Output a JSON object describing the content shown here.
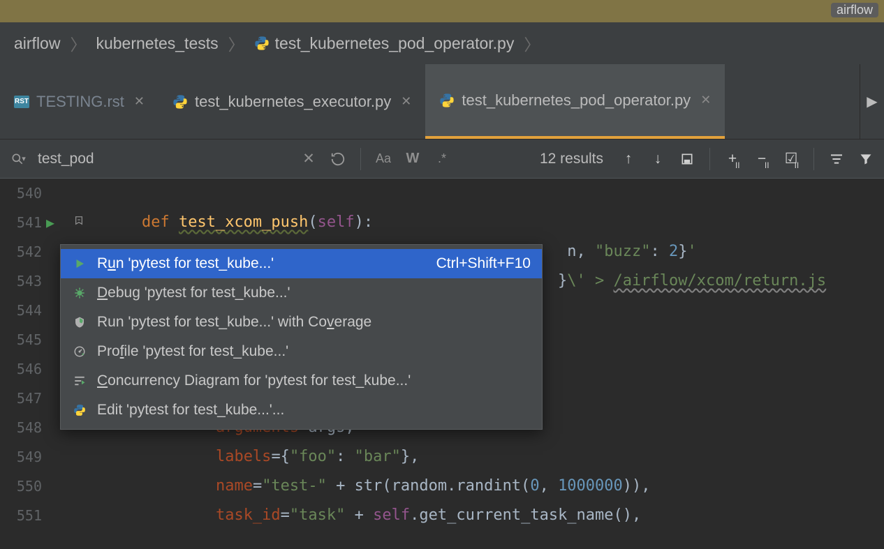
{
  "title_badge": "airflow",
  "breadcrumb": {
    "items": [
      "airflow",
      "kubernetes_tests",
      "test_kubernetes_pod_operator.py"
    ]
  },
  "tabs": [
    {
      "label": "TESTING.rst",
      "icon": "rst",
      "active": false,
      "tint": "inactive"
    },
    {
      "label": "test_kubernetes_executor.py",
      "icon": "py",
      "active": false,
      "tint": "normal"
    },
    {
      "label": "test_kubernetes_pod_operator.py",
      "icon": "py",
      "active": true,
      "tint": "normal"
    }
  ],
  "find": {
    "query": "test_pod",
    "results_label": "12 results"
  },
  "editor": {
    "first_line_no": 540,
    "lines": [
      {
        "no": 540,
        "frag": []
      },
      {
        "no": 541,
        "run_gutter": true,
        "frag": [
          {
            "cls": "",
            "t": "    "
          },
          {
            "cls": "k-def",
            "t": "def "
          },
          {
            "cls": "k-fn",
            "t": "test_xcom_push"
          },
          {
            "cls": "",
            "t": "("
          },
          {
            "cls": "k-self",
            "t": "self"
          },
          {
            "cls": "",
            "t": "):"
          }
        ]
      },
      {
        "no": 542,
        "frag": [
          {
            "cls": "",
            "t": "                                                  n, "
          },
          {
            "cls": "k-str",
            "t": "\"buzz\""
          },
          {
            "cls": "",
            "t": ": "
          },
          {
            "cls": "k-num",
            "t": "2"
          },
          {
            "cls": "",
            "t": "}"
          },
          {
            "cls": "k-str",
            "t": "'"
          }
        ]
      },
      {
        "no": 543,
        "frag": [
          {
            "cls": "",
            "t": "                                                 }"
          },
          {
            "cls": "k-str",
            "t": "\\'"
          },
          {
            "cls": "k-str",
            "t": " > "
          },
          {
            "cls": "k-path",
            "t": "/airflow/xcom/return.js"
          }
        ]
      },
      {
        "no": 544,
        "frag": []
      },
      {
        "no": 545,
        "frag": []
      },
      {
        "no": 546,
        "frag": []
      },
      {
        "no": 547,
        "frag": []
      },
      {
        "no": 548,
        "frag": [
          {
            "cls": "",
            "t": "            "
          },
          {
            "cls": "k-arg",
            "t": "arguments"
          },
          {
            "cls": "",
            "t": "=args,"
          }
        ]
      },
      {
        "no": 549,
        "frag": [
          {
            "cls": "",
            "t": "            "
          },
          {
            "cls": "k-arg",
            "t": "labels"
          },
          {
            "cls": "",
            "t": "={"
          },
          {
            "cls": "k-str",
            "t": "\"foo\""
          },
          {
            "cls": "",
            "t": ": "
          },
          {
            "cls": "k-str",
            "t": "\"bar\""
          },
          {
            "cls": "",
            "t": "},"
          }
        ]
      },
      {
        "no": 550,
        "frag": [
          {
            "cls": "",
            "t": "            "
          },
          {
            "cls": "k-arg",
            "t": "name"
          },
          {
            "cls": "",
            "t": "="
          },
          {
            "cls": "k-str",
            "t": "\"test-\""
          },
          {
            "cls": "",
            "t": " + str(random.randint("
          },
          {
            "cls": "k-num",
            "t": "0"
          },
          {
            "cls": "",
            "t": ", "
          },
          {
            "cls": "k-num",
            "t": "1000000"
          },
          {
            "cls": "",
            "t": ")),"
          }
        ]
      },
      {
        "no": 551,
        "frag": [
          {
            "cls": "",
            "t": "            "
          },
          {
            "cls": "k-arg",
            "t": "task_id"
          },
          {
            "cls": "",
            "t": "="
          },
          {
            "cls": "k-str",
            "t": "\"task\""
          },
          {
            "cls": "",
            "t": " + "
          },
          {
            "cls": "k-self",
            "t": "self"
          },
          {
            "cls": "",
            "t": ".get_current_task_name(),"
          }
        ]
      }
    ]
  },
  "context_menu": [
    {
      "icon": "run",
      "label_pre": "R",
      "label_u": "u",
      "label_post": "n 'pytest for test_kube...'",
      "shortcut": "Ctrl+Shift+F10",
      "selected": true
    },
    {
      "icon": "debug",
      "label_pre": "",
      "label_u": "D",
      "label_post": "ebug 'pytest for test_kube...'",
      "shortcut": ""
    },
    {
      "icon": "coverage",
      "label_pre": "Run 'pytest for test_kube...' with Co",
      "label_u": "v",
      "label_post": "erage",
      "shortcut": ""
    },
    {
      "icon": "profile",
      "label_pre": "Pro",
      "label_u": "f",
      "label_post": "ile 'pytest for test_kube...'",
      "shortcut": ""
    },
    {
      "icon": "concurrency",
      "label_pre": "",
      "label_u": "C",
      "label_post": "oncurrency Diagram for 'pytest for test_kube...'",
      "shortcut": ""
    },
    {
      "icon": "edit",
      "label_pre": "Edit 'pytest for test_kube...'...",
      "label_u": "",
      "label_post": "",
      "shortcut": ""
    }
  ]
}
